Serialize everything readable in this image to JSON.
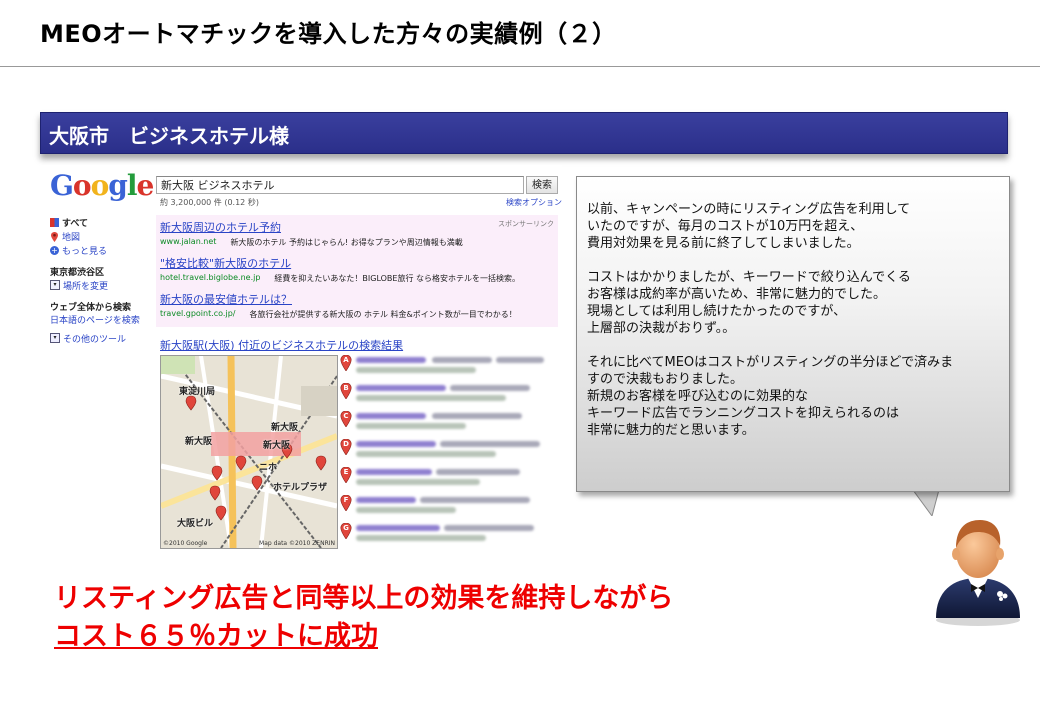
{
  "slide": {
    "title": "MEOオートマチックを導入した方々の実績例（２）",
    "banner": "大阪市　ビジネスホテル様"
  },
  "serp": {
    "logo_letters": [
      "G",
      "o",
      "o",
      "g",
      "l",
      "e"
    ],
    "logo_colors": [
      "#3a63d6",
      "#d9342b",
      "#f1b31c",
      "#3a63d6",
      "#249c3c",
      "#d9342b"
    ],
    "query": "新大阪 ビジネスホテル",
    "search_button": "検索",
    "result_count": "約 3,200,000 件 (0.12 秒)",
    "search_options": "検索オプション",
    "nav": {
      "everything": "すべて",
      "maps": "地図",
      "more": "もっと見る",
      "location_heading": "東京都渋谷区",
      "change_location": "場所を変更",
      "web_heading": "ウェブ全体から検索",
      "japanese_pages": "日本語のページを検索",
      "other_tools": "その他のツール"
    },
    "sponsored_label": "スポンサーリンク",
    "ads": [
      {
        "title": "新大阪周辺のホテル予約",
        "url": "www.jalan.net",
        "desc": "新大阪のホテル 予約はじゃらん! お得なプランや周辺情報も満載"
      },
      {
        "title": "\"格安比較\"新大阪のホテル",
        "url": "hotel.travel.biglobe.ne.jp",
        "desc": "経費を抑えたいあなた！BIGLOBE旅行 なら格安ホテルを一括検索。"
      },
      {
        "title": "新大阪の最安値ホテルは？",
        "url": "travel.gpoint.co.jp/",
        "desc": "各旅行会社が提供する新大阪の ホテル 料金&ポイント数が一目でわかる！"
      }
    ],
    "map_heading": "新大阪駅(大阪) 付近のビジネスホテルの検索結果",
    "map": {
      "labels": [
        "東淀川局",
        "新大阪",
        "新大阪",
        "新大阪",
        "大阪ビル",
        "ニホ",
        "ホテルプラザ"
      ],
      "copyright": "©2010 Google",
      "data_credit": "Map data ©2010 ZENRIN"
    },
    "pins": [
      "A",
      "B",
      "C",
      "D",
      "E",
      "F",
      "G"
    ],
    "pin_color": "#e0463c"
  },
  "bubble": {
    "paragraphs": [
      [
        "以前、キャンペーンの時にリスティング広告を利用して",
        "いたのですが、毎月のコストが10万円を超え、",
        "費用対効果を見る前に終了してしまいました。"
      ],
      [
        "コストはかかりましたが、キーワードで絞り込んでくる",
        "お客様は成約率が高いため、非常に魅力的でした。",
        "現場としては利用し続けたかったのですが、",
        "上層部の決裁がおりず。。"
      ],
      [
        "それに比べてMEOはコストがリスティングの半分ほどで済みま",
        "すので決裁もおりました。",
        "新規のお客様を呼び込むのに効果的な",
        "キーワード広告でランニングコストを抑えられるのは",
        "非常に魅力的だと思います。"
      ]
    ]
  },
  "headline": {
    "line1": "リスティング広告と同等以上の効果を維持しながら",
    "line2": "コスト６５％カットに成功"
  },
  "colors": {
    "banner": "#2f338f",
    "headline": "#ee0000",
    "link": "#2a44c6",
    "url_green": "#0b8a24"
  }
}
